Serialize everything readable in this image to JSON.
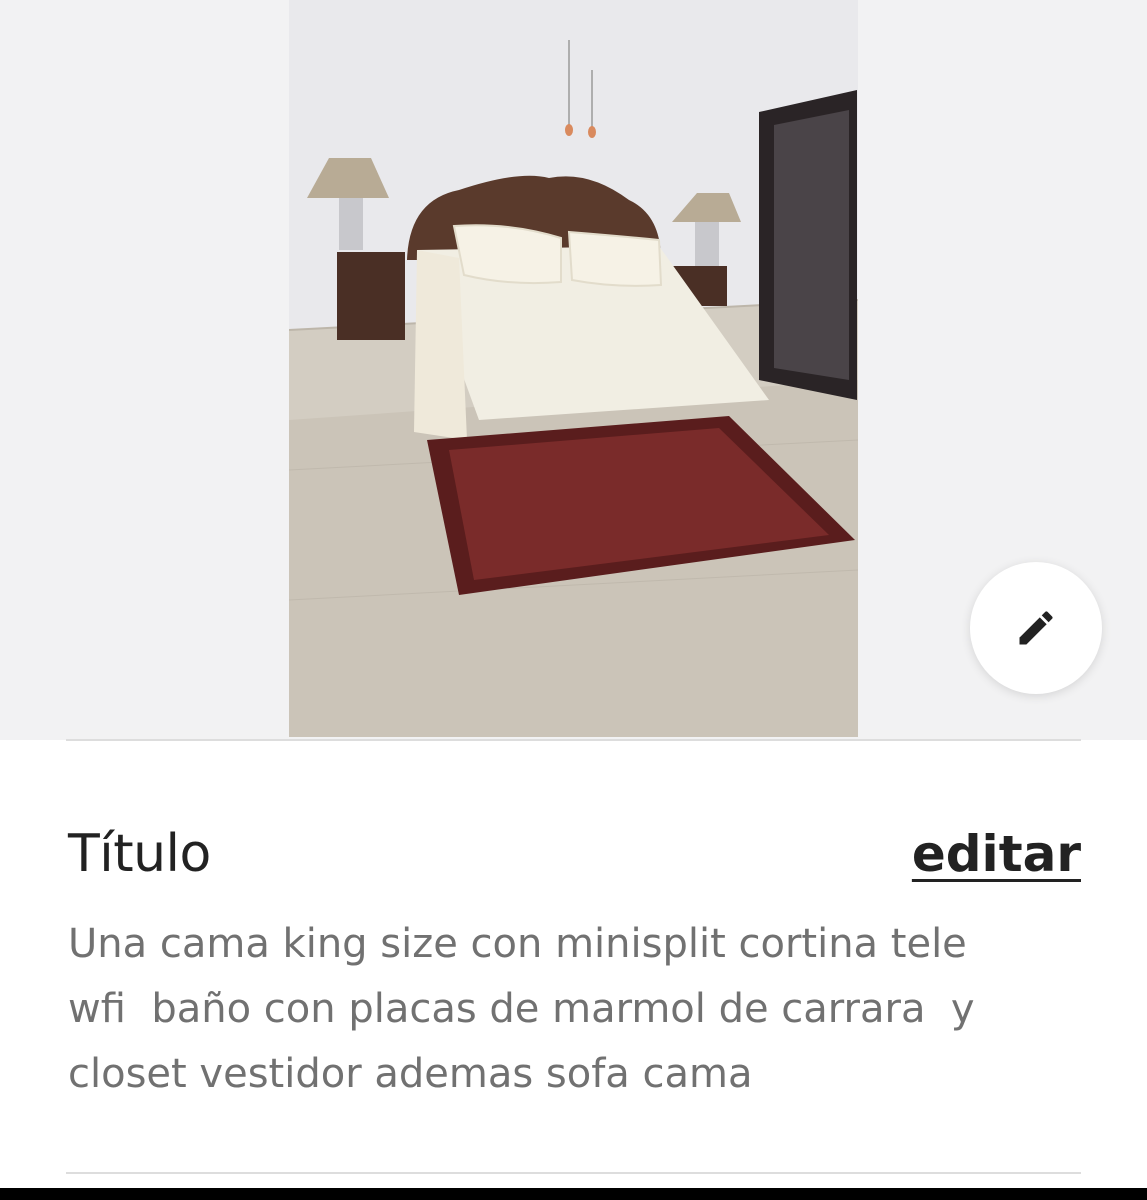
{
  "listing": {
    "photo_alt": "bedroom-photo",
    "edit_icon": "pencil-icon"
  },
  "section": {
    "title": "Título",
    "edit_label": "editar",
    "description": "Una cama king size con minisplit cortina tele\nwfi  baño con placas de marmol de carrara  y\ncloset vestidor ademas sofa cama"
  },
  "colors": {
    "background": "#ffffff",
    "photo_backdrop": "#f2f2f3",
    "title_text": "#222222",
    "body_text": "#717171",
    "divider": "#dddddd"
  }
}
